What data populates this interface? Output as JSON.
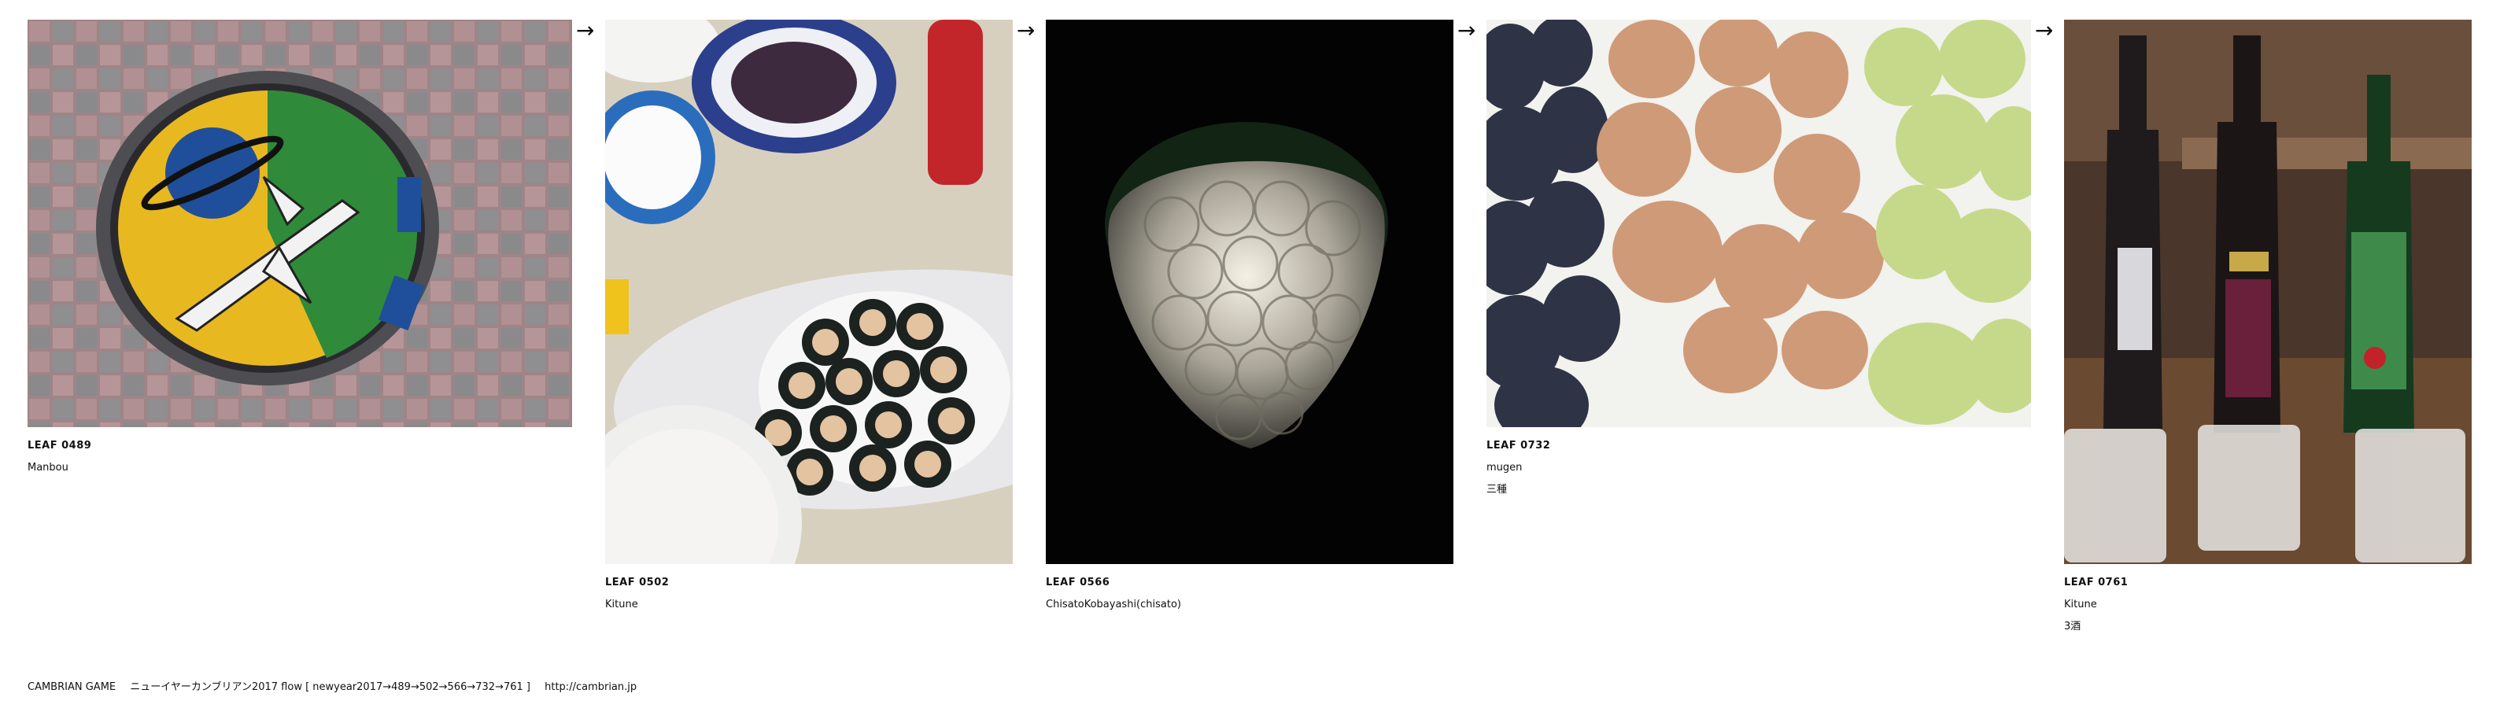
{
  "leaves": [
    {
      "id": "LEAF 0489",
      "author": "Manbou",
      "caption": "",
      "image": "manhole-cover-photo"
    },
    {
      "id": "LEAF 0502",
      "author": "Kitune",
      "caption": "",
      "image": "sushi-rolls-photo"
    },
    {
      "id": "LEAF 0566",
      "author": "ChisatoKobayashi(chisato)",
      "caption": "",
      "image": "grape-lamp-photo"
    },
    {
      "id": "LEAF 0732",
      "author": "mugen",
      "caption": "三種",
      "image": "grapes-photo"
    },
    {
      "id": "LEAF 0761",
      "author": "Kitune",
      "caption": "3酒",
      "image": "sake-bottles-photo"
    }
  ],
  "arrow_glyph": "→",
  "footer": {
    "title": "CAMBRIAN GAME",
    "flow": "ニューイヤーカンブリアン2017  flow [ newyear2017→489→502→566→732→761 ]",
    "url": "http://cambrian.jp"
  },
  "colors": {
    "background": "#ffffff",
    "text": "#111111",
    "manhole_yellow": "#e8b820",
    "manhole_green": "#2f8a3a",
    "manhole_blue": "#1f4f9a",
    "brick": "#a78a8c",
    "grape_green": "#c6d98a",
    "grape_red": "#d8a67a",
    "grape_dark": "#2e3446",
    "night": "#030303"
  }
}
